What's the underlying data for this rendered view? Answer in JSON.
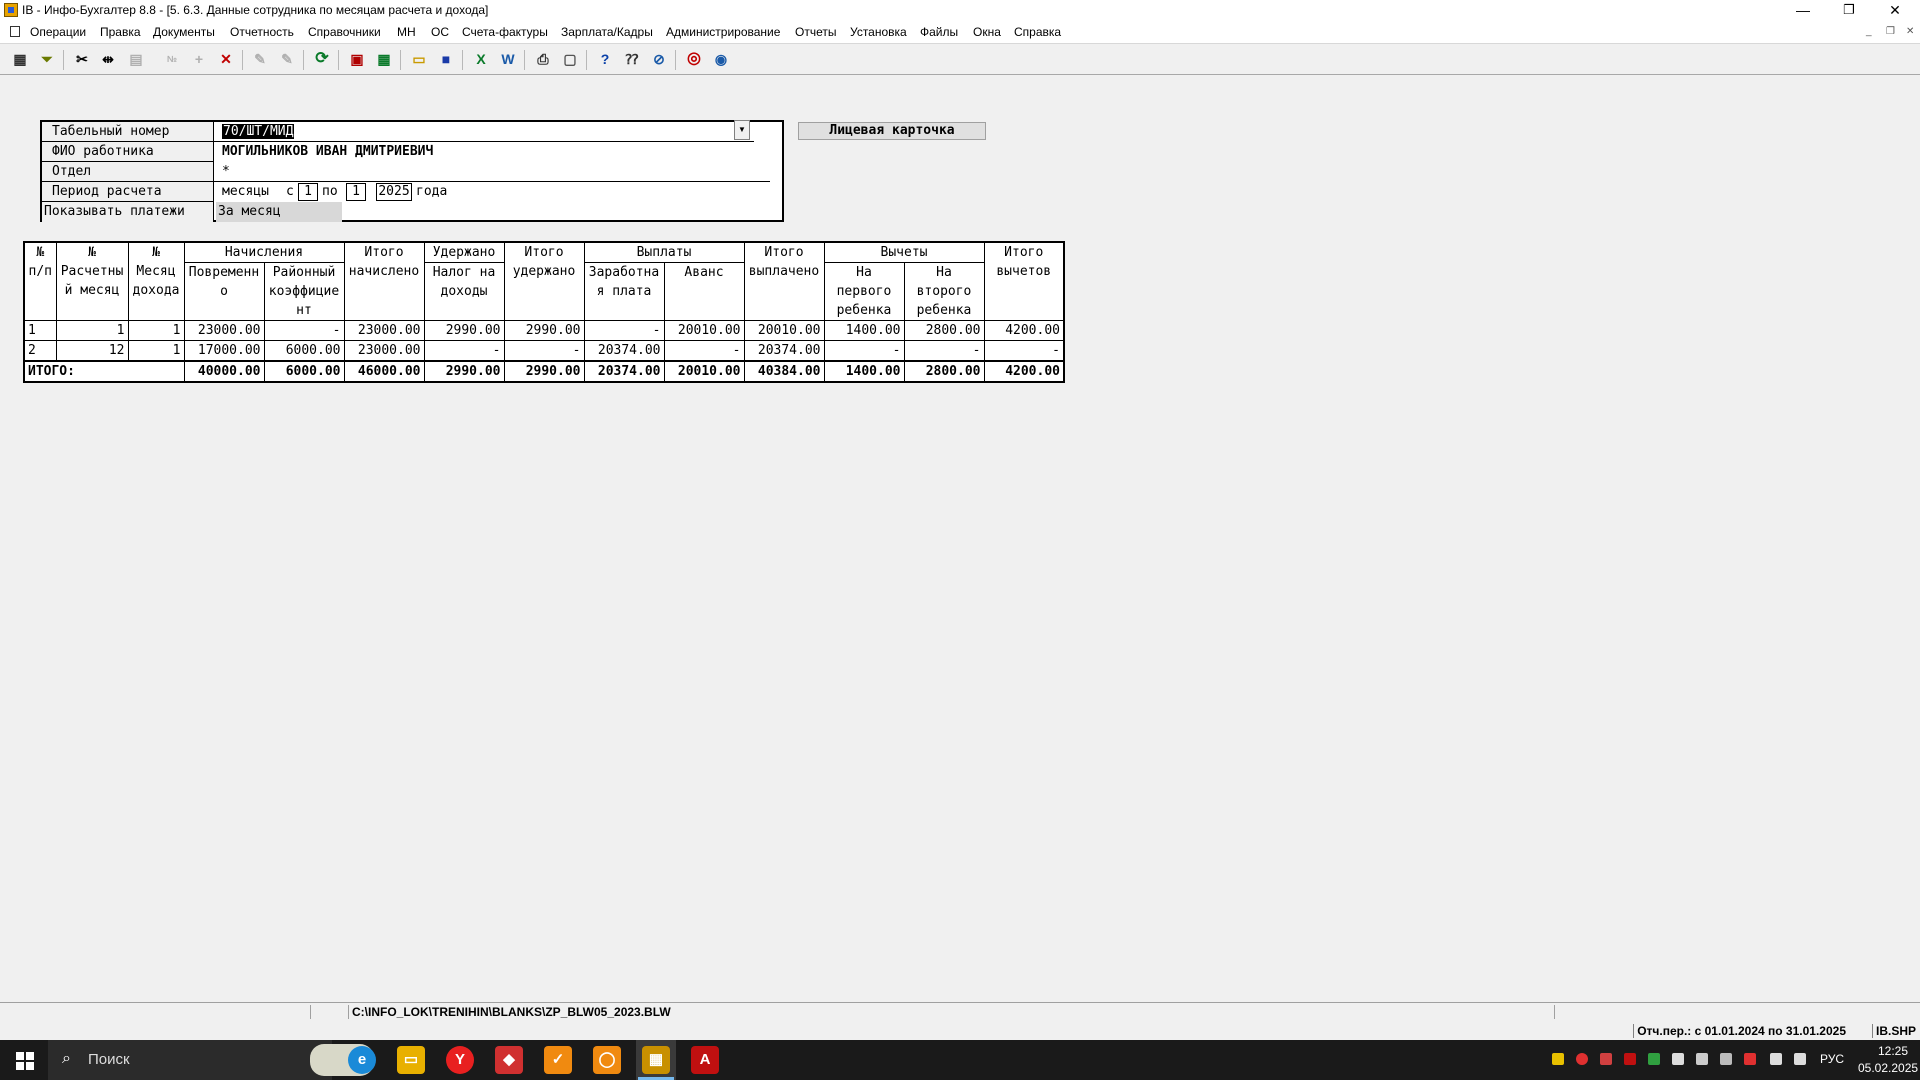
{
  "window": {
    "title": "IB - Инфо-Бухгалтер 8.8 - [5. 6.3. Данные сотрудника по месяцам расчета и дохода]",
    "minimize": "—",
    "restore": "❐",
    "close": "✕"
  },
  "menu": [
    "Операции",
    "Правка",
    "Документы",
    "Отчетность",
    "Справочники",
    "МН",
    "ОС",
    "Счета-фактуры",
    "Зарплата/Кадры",
    "Администрирование",
    "Отчеты",
    "Установка",
    "Файлы",
    "Окна",
    "Справка"
  ],
  "toolbar_icons": [
    "table-icon",
    "filter-icon",
    "cut-icon",
    "split-icon",
    "paste-icon",
    "numbers-icon",
    "plus-icon",
    "delete-icon",
    "tool-icon",
    "tool2-icon",
    "refresh-icon",
    "pdf-icon",
    "calc-icon",
    "open-folder-icon",
    "save-icon",
    "excel-icon",
    "word-icon",
    "print-icon",
    "preview-icon",
    "help-icon",
    "context-help-icon",
    "compass-icon",
    "lifebuoy-icon",
    "globe-icon"
  ],
  "form": {
    "tab_label": "Табельный номер",
    "tab_value": "70/ШТ/МИД",
    "fio_label": "ФИО работника",
    "fio_value": "МОГИЛЬНИКОВ ИВАН ДМИТРИЕВИЧ",
    "dept_label": "Отдел",
    "dept_value": "*",
    "period_label": "Период расчета",
    "period_months": "месяцы",
    "period_from_word": "с",
    "period_from": "1",
    "period_to_word": "по",
    "period_to": "1",
    "period_year": "2025",
    "period_year_word": "года",
    "show_label": "Показывать платежи",
    "show_value": "За месяц",
    "card_button": "Лицевая карточка"
  },
  "table": {
    "headers": {
      "num_pp_1": "№",
      "num_pp_2": "п/п",
      "calc_month_1": "№",
      "calc_month_2": "Расчетны",
      "calc_month_3": "й месяц",
      "inc_month_1": "№",
      "inc_month_2": "Месяц",
      "inc_month_3": "дохода",
      "accruals": "Начисления",
      "time_1": "Повременн",
      "time_2": "о",
      "reg_1": "Районный",
      "reg_2": "коэффицие",
      "reg_3": "нт",
      "total_acc_1": "Итого",
      "total_acc_2": "начислено",
      "withheld_1": "Удержано",
      "tax_1": "Налог на",
      "tax_2": "доходы",
      "total_with_1": "Итого",
      "total_with_2": "удержано",
      "payments": "Выплаты",
      "salary_1": "Заработна",
      "salary_2": "я плата",
      "advance": "Аванс",
      "total_paid_1": "Итого",
      "total_paid_2": "выплачено",
      "deductions": "Вычеты",
      "first_1": "На",
      "first_2": "первого",
      "first_3": "ребенка",
      "second_1": "На",
      "second_2": "второго",
      "second_3": "ребенка",
      "total_ded_1": "Итого",
      "total_ded_2": "вычетов"
    },
    "rows": [
      [
        "1",
        "1",
        "1",
        "23000.00",
        "-",
        "23000.00",
        "2990.00",
        "2990.00",
        "-",
        "20010.00",
        "20010.00",
        "1400.00",
        "2800.00",
        "4200.00"
      ],
      [
        "2",
        "12",
        "1",
        "17000.00",
        "6000.00",
        "23000.00",
        "-",
        "-",
        "20374.00",
        "-",
        "20374.00",
        "-",
        "-",
        "-"
      ]
    ],
    "total": {
      "label": "ИТОГО:",
      "values": [
        "40000.00",
        "6000.00",
        "46000.00",
        "2990.00",
        "2990.00",
        "20374.00",
        "20010.00",
        "40384.00",
        "1400.00",
        "2800.00",
        "4200.00"
      ]
    }
  },
  "status": {
    "path": "C:\\INFO_LOK\\TRENIHIN\\BLANKS\\ZP_BLW05_2023.BLW",
    "period": "Отч.пер.: с 01.01.2024 по 31.01.2025",
    "db": "IB.SHP"
  },
  "taskbar": {
    "search": "Поиск",
    "lang": "РУС",
    "time": "12:25",
    "date": "05.02.2025"
  }
}
